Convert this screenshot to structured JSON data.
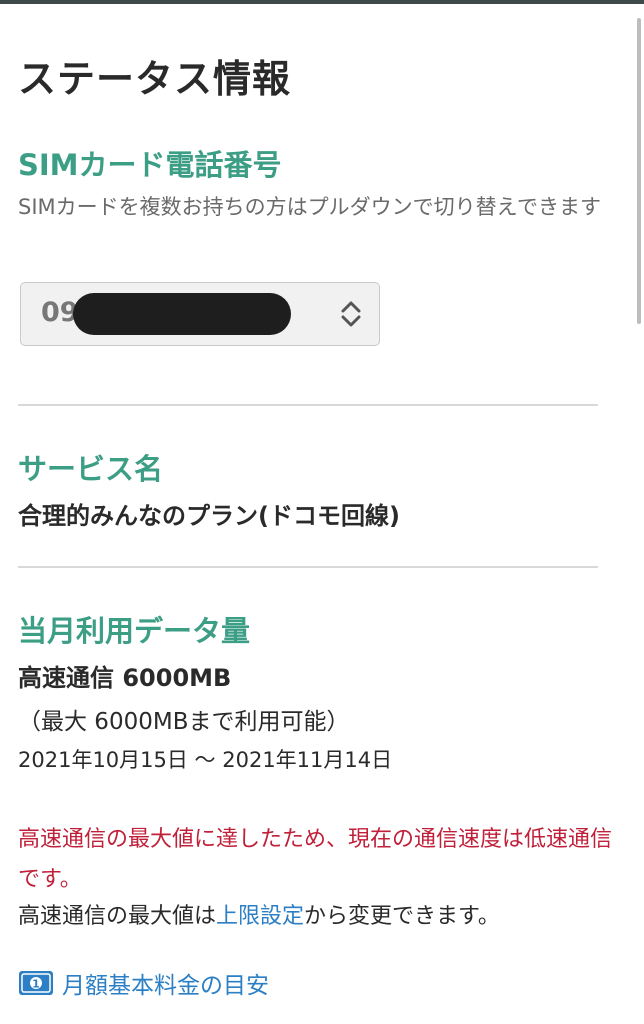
{
  "page": {
    "title": "ステータス情報"
  },
  "sim": {
    "heading": "SIMカード電話番号",
    "description": "SIMカードを複数お持ちの方はプルダウンで切り替えできます",
    "selected_value": "09",
    "select_icon": "updown-chevron-icon"
  },
  "service": {
    "heading": "サービス名",
    "value": "合理的みんなのプラン(ドコモ回線)"
  },
  "data_usage": {
    "heading": "当月利用データ量",
    "high_speed": "高速通信 6000MB",
    "max_note": "（最大 6000MBまで利用可能）",
    "period": "2021年10月15日 ～ 2021年11月14日",
    "warning": "高速通信の最大値に達したため、現在の通信速度は低速通信です。",
    "note_prefix": "高速通信の最大値は",
    "note_link": "上限設定",
    "note_suffix": "から変更できます。"
  },
  "fee_link": {
    "label": "月額基本料金の目安",
    "icon": "money-bill-icon"
  },
  "colors": {
    "accent_green": "#3d9e86",
    "warning_red": "#c0203a",
    "link_blue": "#2c7fc4"
  }
}
